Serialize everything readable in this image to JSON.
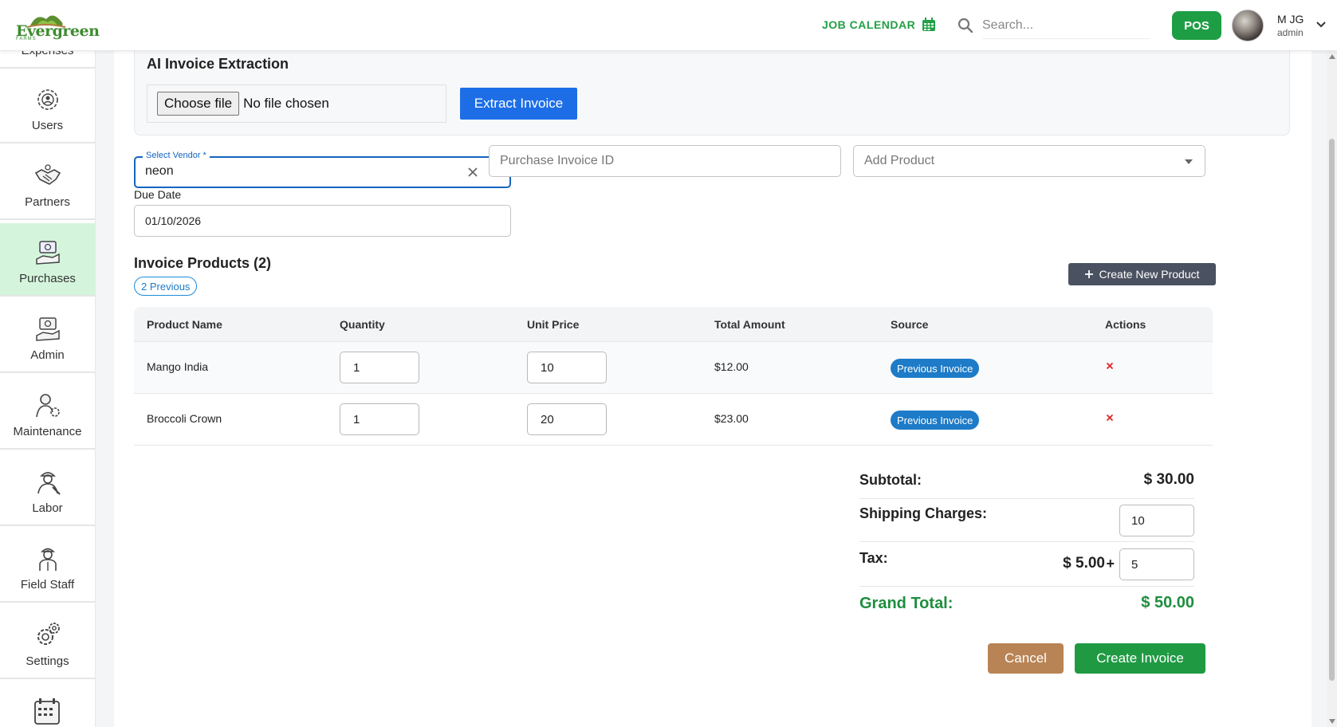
{
  "header": {
    "logo_text": "Evergreen",
    "logo_sub": "FARMS",
    "job_calendar": "JOB CALENDAR",
    "search_placeholder": "Search...",
    "pos": "POS",
    "user_name": "M JG",
    "user_role": "admin"
  },
  "sidebar": {
    "items": [
      {
        "label": "Expenses"
      },
      {
        "label": "Users"
      },
      {
        "label": "Partners"
      },
      {
        "label": "Purchases",
        "active": true
      },
      {
        "label": "Admin"
      },
      {
        "label": "Maintenance"
      },
      {
        "label": "Labor"
      },
      {
        "label": "Field Staff"
      },
      {
        "label": "Settings"
      }
    ]
  },
  "extraction": {
    "title": "AI Invoice Extraction",
    "choose_file": "Choose file",
    "no_file": "No file chosen",
    "extract_button": "Extract Invoice"
  },
  "form": {
    "vendor_label": "Select Vendor *",
    "vendor_value": "neon",
    "invoice_id_placeholder": "Purchase Invoice ID",
    "add_product_placeholder": "Add Product",
    "due_date_label": "Due Date",
    "due_date_value": "01/10/2026"
  },
  "invoice": {
    "title": "Invoice Products (2)",
    "previous_pill": "2 Previous",
    "create_product": "Create New Product",
    "columns": [
      "Product Name",
      "Quantity",
      "Unit Price",
      "Total Amount",
      "Source",
      "Actions"
    ],
    "rows": [
      {
        "name": "Mango India",
        "quantity": "1",
        "unit_price": "10",
        "total": "$12.00",
        "source": "Previous Invoice"
      },
      {
        "name": "Broccoli Crown",
        "quantity": "1",
        "unit_price": "20",
        "total": "$23.00",
        "source": "Previous Invoice"
      }
    ]
  },
  "summary": {
    "subtotal_label": "Subtotal:",
    "subtotal_value": "$ 30.00",
    "shipping_label": "Shipping Charges:",
    "shipping_value": "10",
    "tax_label": "Tax:",
    "tax_amount": "$ 5.00",
    "tax_plus": "+",
    "tax_value": "5",
    "grand_label": "Grand Total:",
    "grand_value": "$ 50.00"
  },
  "actions": {
    "cancel": "Cancel",
    "create_invoice": "Create Invoice"
  },
  "colors": {
    "brand_green": "#1f9a43",
    "primary_blue": "#1d6ee6",
    "active_sidebar": "#d4f5dc",
    "cancel_brown": "#b98455"
  }
}
